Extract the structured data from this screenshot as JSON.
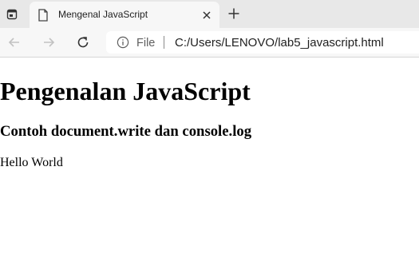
{
  "browser": {
    "tab": {
      "title": "Mengenal JavaScript"
    },
    "address": {
      "scheme": "File",
      "url": "C:/Users/LENOVO/lab5_javascript.html"
    }
  },
  "page": {
    "heading": "Pengenalan JavaScript",
    "subheading": "Contoh document.write dan console.log",
    "output": "Hello World"
  }
}
